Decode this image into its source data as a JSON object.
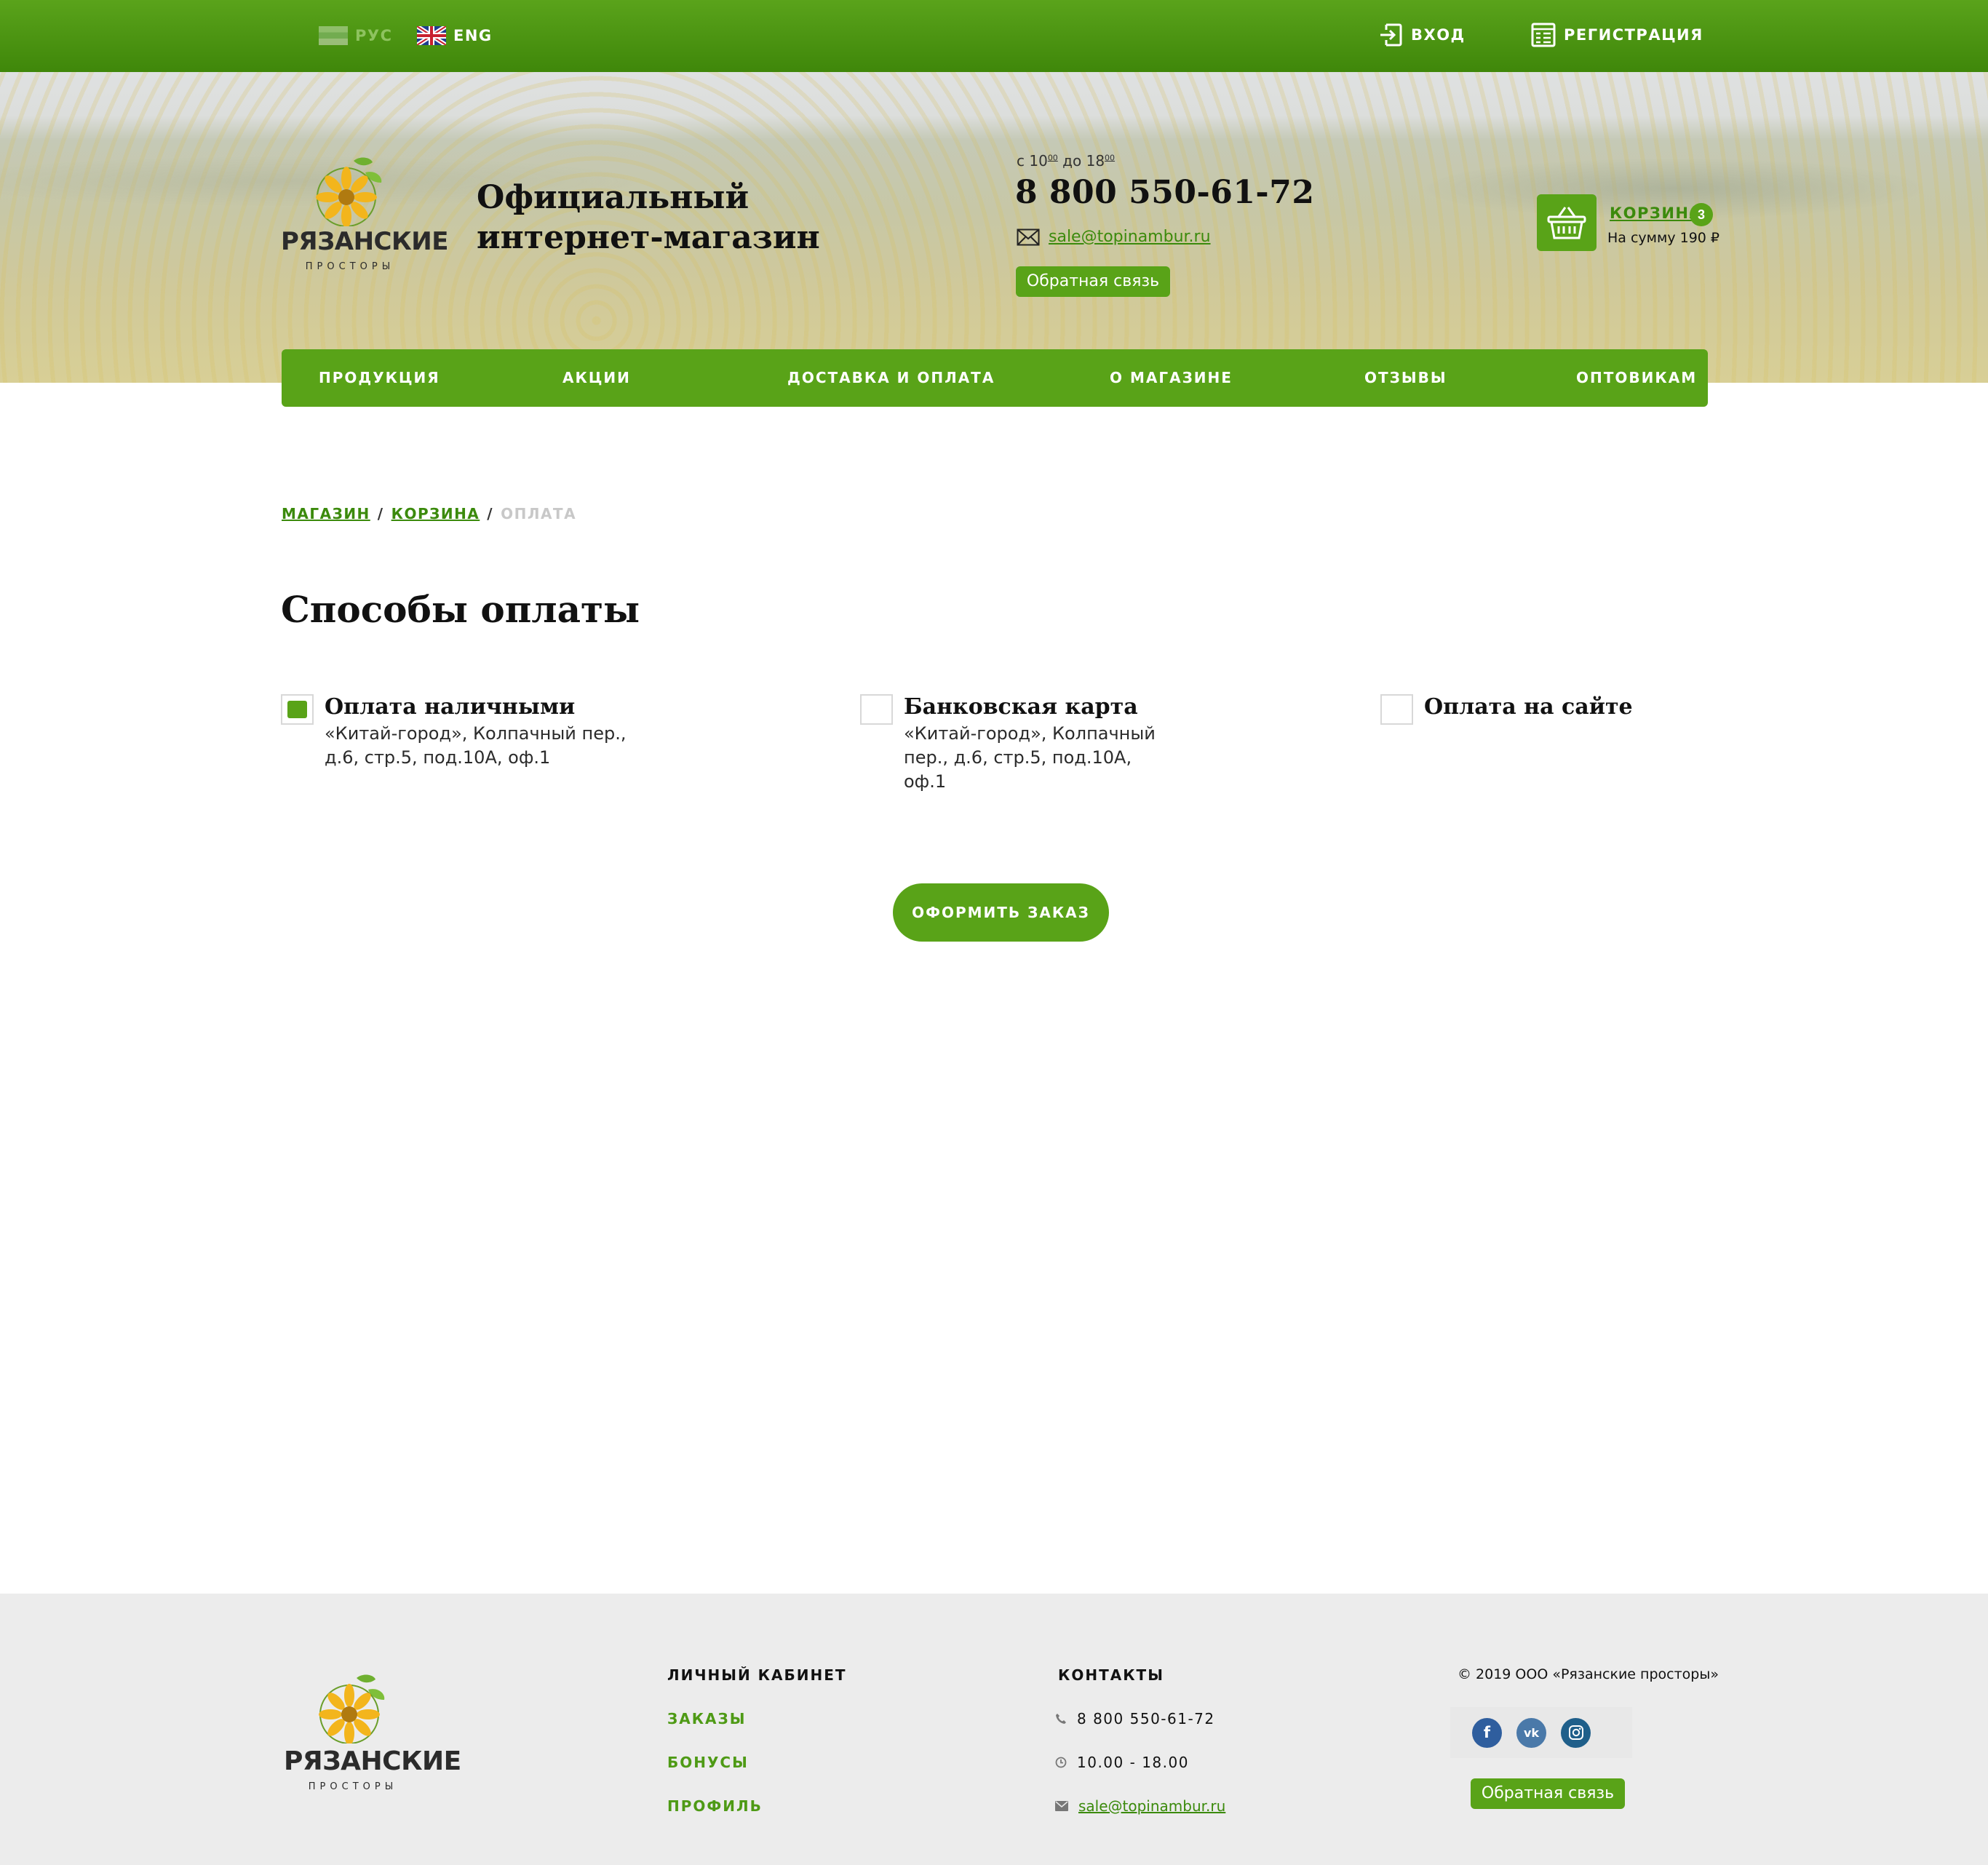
{
  "topbar": {
    "lang_ru": "РУС",
    "lang_en": "ENG",
    "login": "ВХОД",
    "register": "РЕГИСТРАЦИЯ"
  },
  "brand": {
    "name": "РЯЗАНСКИЕ",
    "sub": "ПРОСТОРЫ"
  },
  "header": {
    "tagline_line1": "Официальный",
    "tagline_line2": "интернет-магазин",
    "hours_prefix": "с 10",
    "hours_sup1": "00",
    "hours_mid": " до 18",
    "hours_sup2": "00",
    "phone": "8 800 550-61-72",
    "email": "sale@topinambur.ru",
    "feedback": "Обратная связь"
  },
  "cart": {
    "label": "КОРЗИНА",
    "count": "3",
    "sum": "На сумму 190 ₽"
  },
  "nav": [
    "ПРОДУКЦИЯ",
    "АКЦИИ",
    "ДОСТАВКА И ОПЛАТА",
    "О МАГАЗИНЕ",
    "ОТЗЫВЫ",
    "ОПТОВИКАМ"
  ],
  "breadcrumb": {
    "shop": "МАГАЗИН",
    "cart": "КОРЗИНА",
    "current": "ОПЛАТА",
    "separator": "/"
  },
  "page_title": "Способы оплаты",
  "payment_options": [
    {
      "title": "Оплата наличными",
      "address": "«Китай-город», Колпачный пер., д.6, стр.5, под.10А, оф.1",
      "selected": true
    },
    {
      "title": "Банковская карта",
      "address": "«Китай-город», Колпачный пер., д.6, стр.5, под.10А, оф.1",
      "selected": false
    },
    {
      "title": "Оплата на сайте",
      "address": "",
      "selected": false
    }
  ],
  "order_button": "ОФОРМИТЬ ЗАКАЗ",
  "footer": {
    "account_title": "ЛИЧНЫЙ КАБИНЕТ",
    "account_links": [
      "ЗАКАЗЫ",
      "БОНУСЫ",
      "ПРОФИЛЬ"
    ],
    "contacts_title": "КОНТАКТЫ",
    "phone": "8 800 550-61-72",
    "hours": "10.00 - 18.00",
    "email": "sale@topinambur.ru",
    "copyright": "© 2019 ООО «Рязанские просторы»",
    "socials": [
      "facebook-icon",
      "vk-icon",
      "instagram-icon"
    ],
    "feedback": "Обратная связь"
  },
  "colors": {
    "brand_green": "#59a318",
    "link_green": "#3b8a0c",
    "footer_bg": "#ececec"
  }
}
